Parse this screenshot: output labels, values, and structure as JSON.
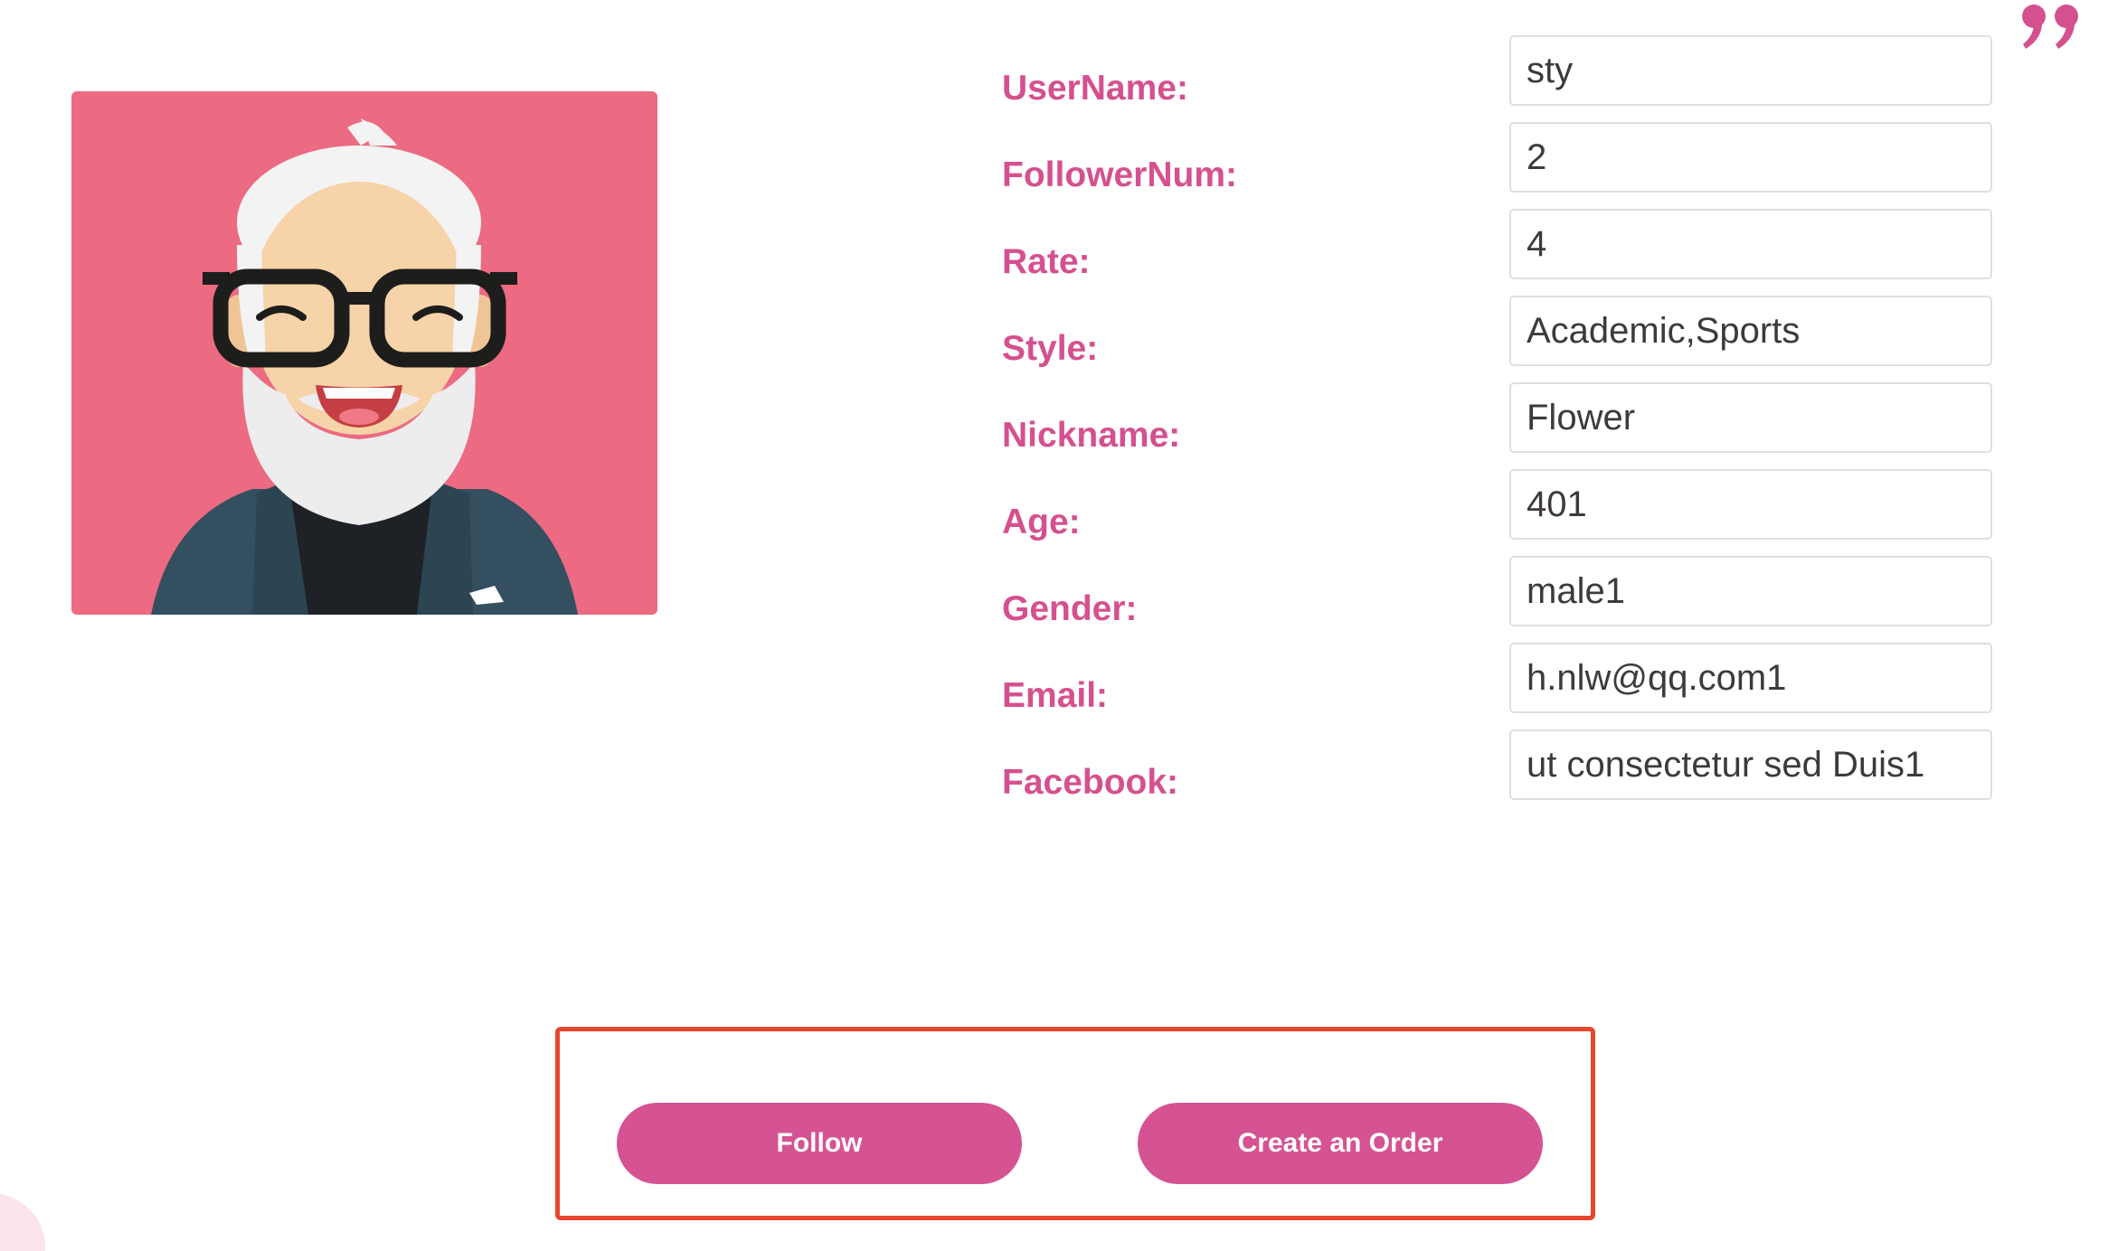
{
  "profile": {
    "avatar_icon": "elderly-man-avatar",
    "fields": [
      {
        "label": "UserName:",
        "value": "sty"
      },
      {
        "label": "FollowerNum:",
        "value": "2"
      },
      {
        "label": "Rate:",
        "value": "4"
      },
      {
        "label": "Style:",
        "value": "Academic,Sports"
      },
      {
        "label": "Nickname:",
        "value": "Flower"
      },
      {
        "label": "Age:",
        "value": "401"
      },
      {
        "label": "Gender:",
        "value": "male1"
      },
      {
        "label": "Email:",
        "value": "h.nlw@qq.com1"
      },
      {
        "label": "Facebook:",
        "value": "ut consectetur sed Duis1"
      }
    ]
  },
  "actions": {
    "follow_label": "Follow",
    "order_label": "Create an Order"
  },
  "decoration": {
    "quote_icon": "quote-mark-icon"
  },
  "colors": {
    "accent": "#d5508f",
    "button": "#d55393",
    "avatar_background": "#ec6a82",
    "highlight_frame": "#e6462e"
  }
}
